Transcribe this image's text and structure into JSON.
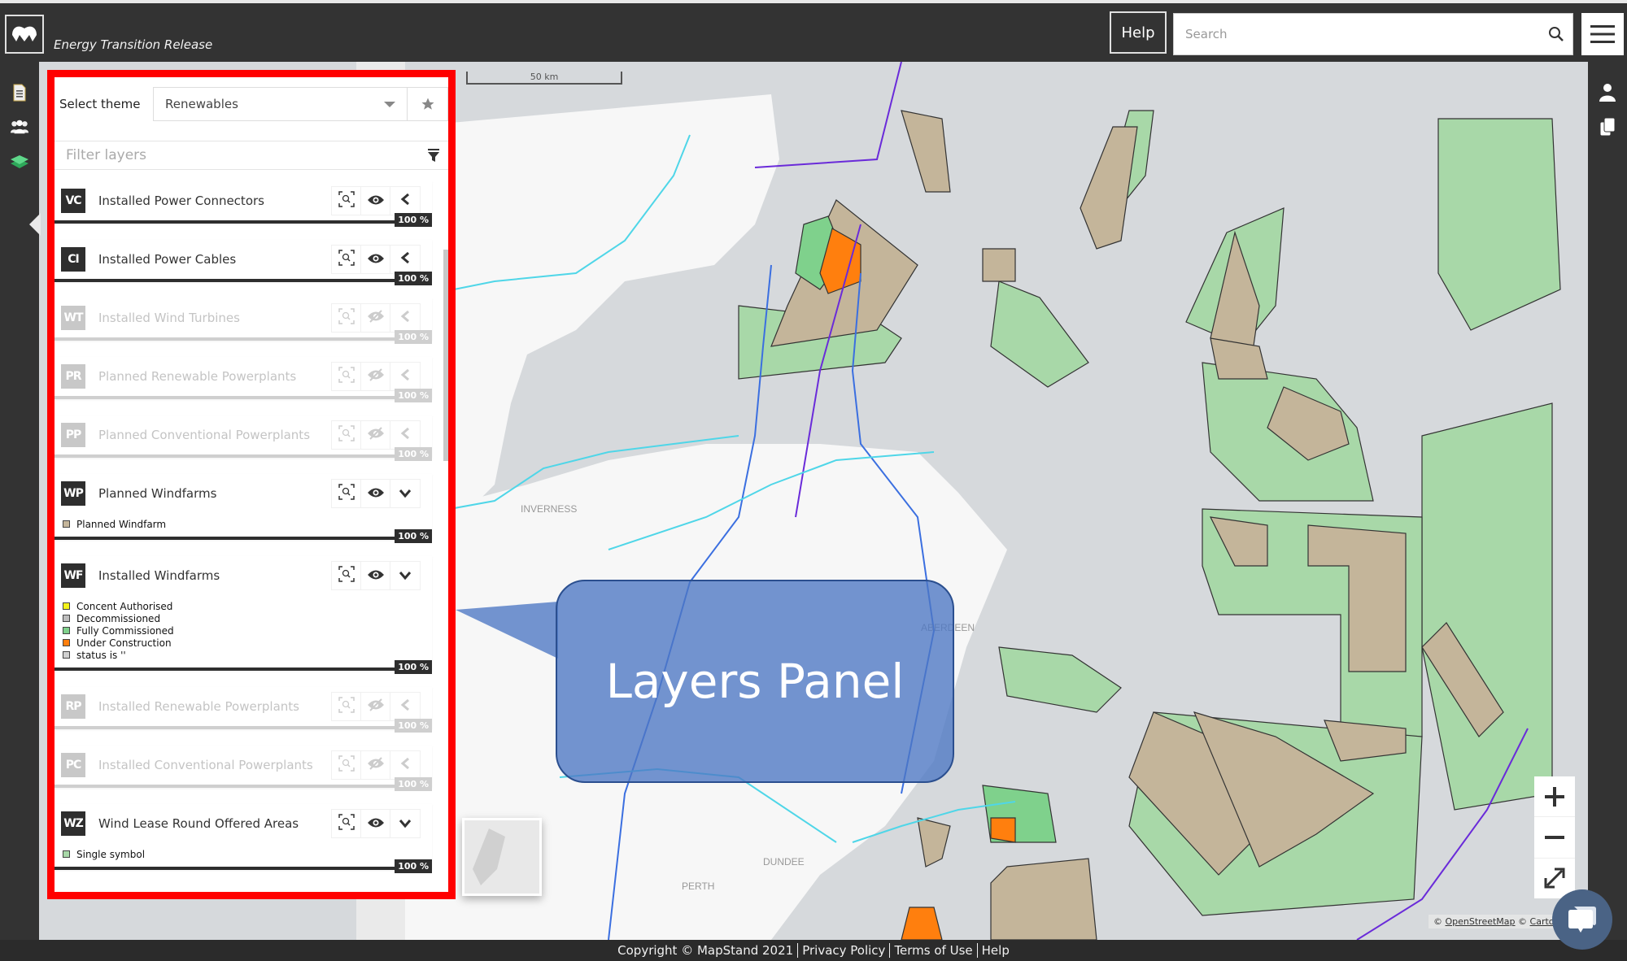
{
  "header": {
    "app_title": "Energy Transition Release",
    "help_label": "Help",
    "search_placeholder": "Search",
    "search_value": ""
  },
  "left_rail": {
    "items": [
      {
        "name": "documents",
        "icon": "document-icon"
      },
      {
        "name": "users",
        "icon": "users-group-icon"
      },
      {
        "name": "layers",
        "icon": "layers-icon",
        "active": true
      }
    ]
  },
  "right_rail": {
    "items": [
      {
        "name": "account",
        "icon": "user-icon"
      },
      {
        "name": "copy",
        "icon": "copy-icon"
      }
    ]
  },
  "layers_panel": {
    "theme_label": "Select theme",
    "theme_value": "Renewables",
    "filter_placeholder": "Filter layers",
    "filter_value": "",
    "layers": [
      {
        "code": "VC",
        "name": "Installed Power Connectors",
        "visible": true,
        "expanded": false,
        "opacity": "100 %",
        "legend": []
      },
      {
        "code": "CI",
        "name": "Installed Power Cables",
        "visible": true,
        "expanded": false,
        "opacity": "100 %",
        "legend": []
      },
      {
        "code": "WT",
        "name": "Installed Wind Turbines",
        "visible": false,
        "expanded": false,
        "opacity": "100 %",
        "legend": []
      },
      {
        "code": "PR",
        "name": "Planned Renewable Powerplants",
        "visible": false,
        "expanded": false,
        "opacity": "100 %",
        "legend": []
      },
      {
        "code": "PP",
        "name": "Planned Conventional Powerplants",
        "visible": false,
        "expanded": false,
        "opacity": "100 %",
        "legend": []
      },
      {
        "code": "WP",
        "name": "Planned Windfarms",
        "visible": true,
        "expanded": true,
        "opacity": "100 %",
        "legend": [
          {
            "label": "Planned Windfarm",
            "color": "#c4b59a"
          }
        ]
      },
      {
        "code": "WF",
        "name": "Installed Windfarms",
        "visible": true,
        "expanded": true,
        "opacity": "100 %",
        "legend": [
          {
            "label": "Concent Authorised",
            "color": "#f4f41a"
          },
          {
            "label": "Decommissioned",
            "color": "#bdbdbd"
          },
          {
            "label": "Fully Commissioned",
            "color": "#7fd18c"
          },
          {
            "label": "Under Construction",
            "color": "#ff7f0e"
          },
          {
            "label": "status is ''",
            "color": "#d0d0d0"
          }
        ]
      },
      {
        "code": "RP",
        "name": "Installed Renewable Powerplants",
        "visible": false,
        "expanded": false,
        "opacity": "100 %",
        "legend": []
      },
      {
        "code": "PC",
        "name": "Installed Conventional Powerplants",
        "visible": false,
        "expanded": false,
        "opacity": "100 %",
        "legend": []
      },
      {
        "code": "WZ",
        "name": "Wind Lease Round Offered Areas",
        "visible": true,
        "expanded": true,
        "opacity": "100 %",
        "legend": [
          {
            "label": "Single symbol",
            "color": "#a8d8a8"
          }
        ]
      }
    ]
  },
  "map": {
    "scale_label": "50 km",
    "place_labels": [
      "INVERNESS",
      "ABERDEEN",
      "DUNDEE",
      "PERTH"
    ],
    "attribution": {
      "osm": "OpenStreetMap",
      "carto": "Carto"
    },
    "colors": {
      "land": "#f7f7f7",
      "sea": "#d6d9dc",
      "planned_windfarm": "#c4b59a",
      "lease_area": "#a8d8a8",
      "under_construction": "#ff7f0e",
      "cable_cyan": "#4fd6e8",
      "cable_blue": "#3b6fe0",
      "cable_purple": "#6a2bd9"
    }
  },
  "callout": {
    "text": "Layers Panel"
  },
  "zoom_controls": {
    "zoom_in": "+",
    "zoom_out": "−"
  },
  "footer": {
    "copyright": "Copyright © MapStand 2021",
    "links": [
      "Privacy Policy",
      "Terms of Use",
      "Help"
    ]
  }
}
